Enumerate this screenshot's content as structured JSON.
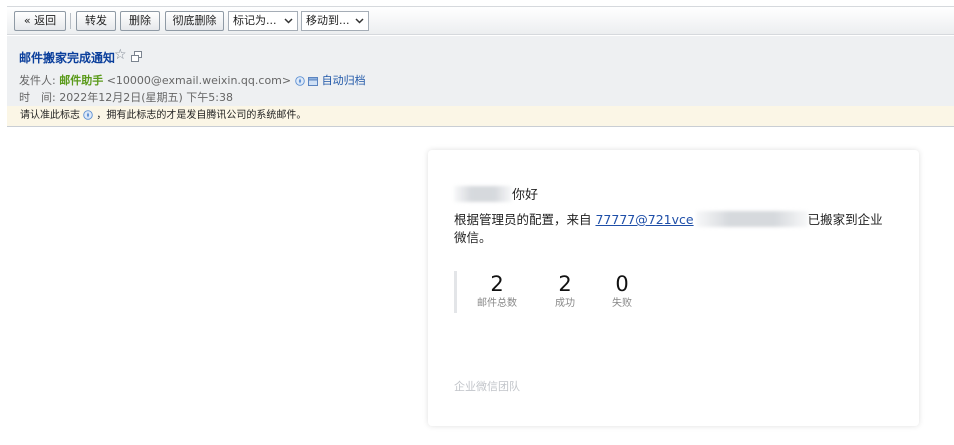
{
  "toolbar": {
    "back_label": "« 返回",
    "forward_label": "转发",
    "delete_label": "删除",
    "perm_delete_label": "彻底删除",
    "mark_as_label": "标记为...",
    "move_to_label": "移动到..."
  },
  "header": {
    "subject": "邮件搬家完成通知",
    "sender_prefix": "发件人:",
    "sender_name": "邮件助手",
    "sender_address": "<10000@exmail.weixin.qq.com>",
    "auto_archive": "自动归档",
    "time_prefix": "时　间:",
    "time_value": "2022年12月2日(星期五) 下午5:38"
  },
  "notice": {
    "text_before": "请认准此标志",
    "text_after": "，拥有此标志的才是发自腾讯公司的系统邮件。"
  },
  "card": {
    "greeting_suffix": "你好",
    "body_prefix": "根据管理员的配置，来自 ",
    "body_link": "77777@721vce",
    "body_suffix": "已搬家到企业微信。",
    "stats": [
      {
        "value": "2",
        "label": "邮件总数"
      },
      {
        "value": "2",
        "label": "成功"
      },
      {
        "value": "0",
        "label": "失败"
      }
    ],
    "footer": "企业微信团队"
  },
  "colors": {
    "subject_link": "#0b3f9c",
    "sender_name": "#5a9a1a",
    "notice_bg": "#fbf6e6",
    "header_bg": "#eef0f2"
  },
  "icons": [
    "star-icon",
    "popout-icon",
    "verified-badge-icon",
    "archive-icon",
    "chevron-down-icon"
  ]
}
